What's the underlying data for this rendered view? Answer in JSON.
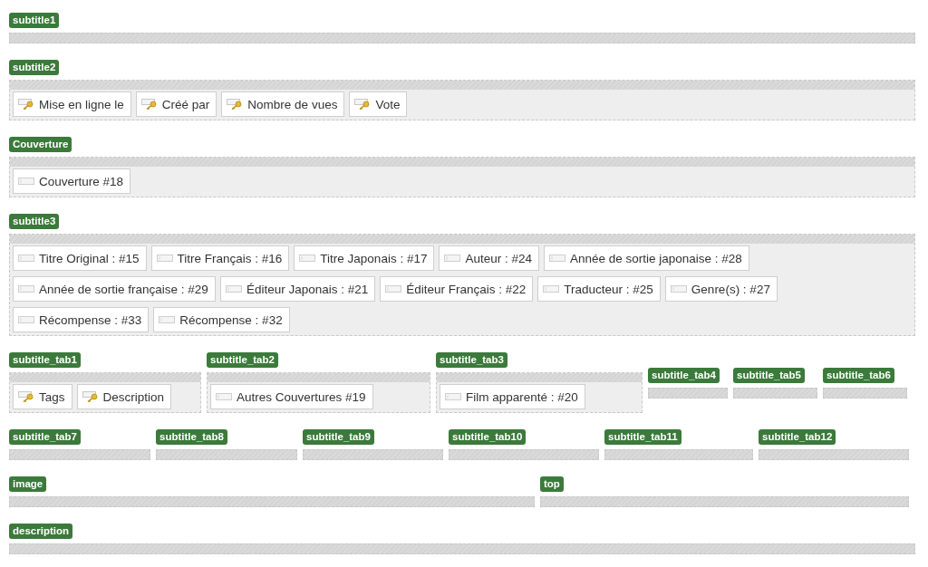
{
  "rows": [
    {
      "zones": [
        {
          "label": "subtitle1"
        }
      ]
    },
    {
      "zones": [
        {
          "label": "subtitle2",
          "fields": [
            {
              "kind": "key",
              "label": "Mise en ligne le"
            },
            {
              "kind": "key",
              "label": "Créé par"
            },
            {
              "kind": "key",
              "label": "Nombre de vues"
            },
            {
              "kind": "key",
              "label": "Vote"
            }
          ]
        }
      ]
    },
    {
      "zones": [
        {
          "label": "Couverture",
          "fields": [
            {
              "kind": "field",
              "label": "Couverture #18"
            }
          ]
        }
      ]
    },
    {
      "zones": [
        {
          "label": "subtitle3",
          "fields": [
            {
              "kind": "field",
              "label": "Titre Original : #15"
            },
            {
              "kind": "field",
              "label": "Titre Français : #16"
            },
            {
              "kind": "field",
              "label": "Titre Japonais : #17"
            },
            {
              "kind": "field",
              "label": "Auteur : #24"
            },
            {
              "kind": "field",
              "label": "Année de sortie japonaise : #28"
            },
            {
              "kind": "field",
              "label": "Année de sortie française : #29"
            },
            {
              "kind": "field",
              "label": "Éditeur Japonais : #21"
            },
            {
              "kind": "field",
              "label": "Éditeur Français : #22"
            },
            {
              "kind": "field",
              "label": "Traducteur : #25"
            },
            {
              "kind": "field",
              "label": "Genre(s) : #27"
            },
            {
              "kind": "field",
              "label": "Récompense : #33"
            },
            {
              "kind": "field",
              "label": "Récompense : #32"
            }
          ]
        }
      ]
    },
    {
      "zones": [
        {
          "label": "subtitle_tab1",
          "fields": [
            {
              "kind": "key",
              "label": "Tags"
            },
            {
              "kind": "key",
              "label": "Description"
            }
          ]
        },
        {
          "label": "subtitle_tab2",
          "fields": [
            {
              "kind": "field",
              "label": "Autres Couvertures #19"
            }
          ]
        },
        {
          "label": "subtitle_tab3",
          "fields": [
            {
              "kind": "field",
              "label": "Film apparenté : #20"
            }
          ]
        },
        {
          "label": "subtitle_tab4"
        },
        {
          "label": "subtitle_tab5"
        },
        {
          "label": "subtitle_tab6"
        }
      ]
    },
    {
      "zones": [
        {
          "label": "subtitle_tab7"
        },
        {
          "label": "subtitle_tab8"
        },
        {
          "label": "subtitle_tab9"
        },
        {
          "label": "subtitle_tab10"
        },
        {
          "label": "subtitle_tab11"
        },
        {
          "label": "subtitle_tab12"
        }
      ]
    },
    {
      "zones": [
        {
          "label": "image"
        },
        {
          "label": "top"
        }
      ]
    },
    {
      "zones": [
        {
          "label": "description"
        }
      ]
    }
  ]
}
